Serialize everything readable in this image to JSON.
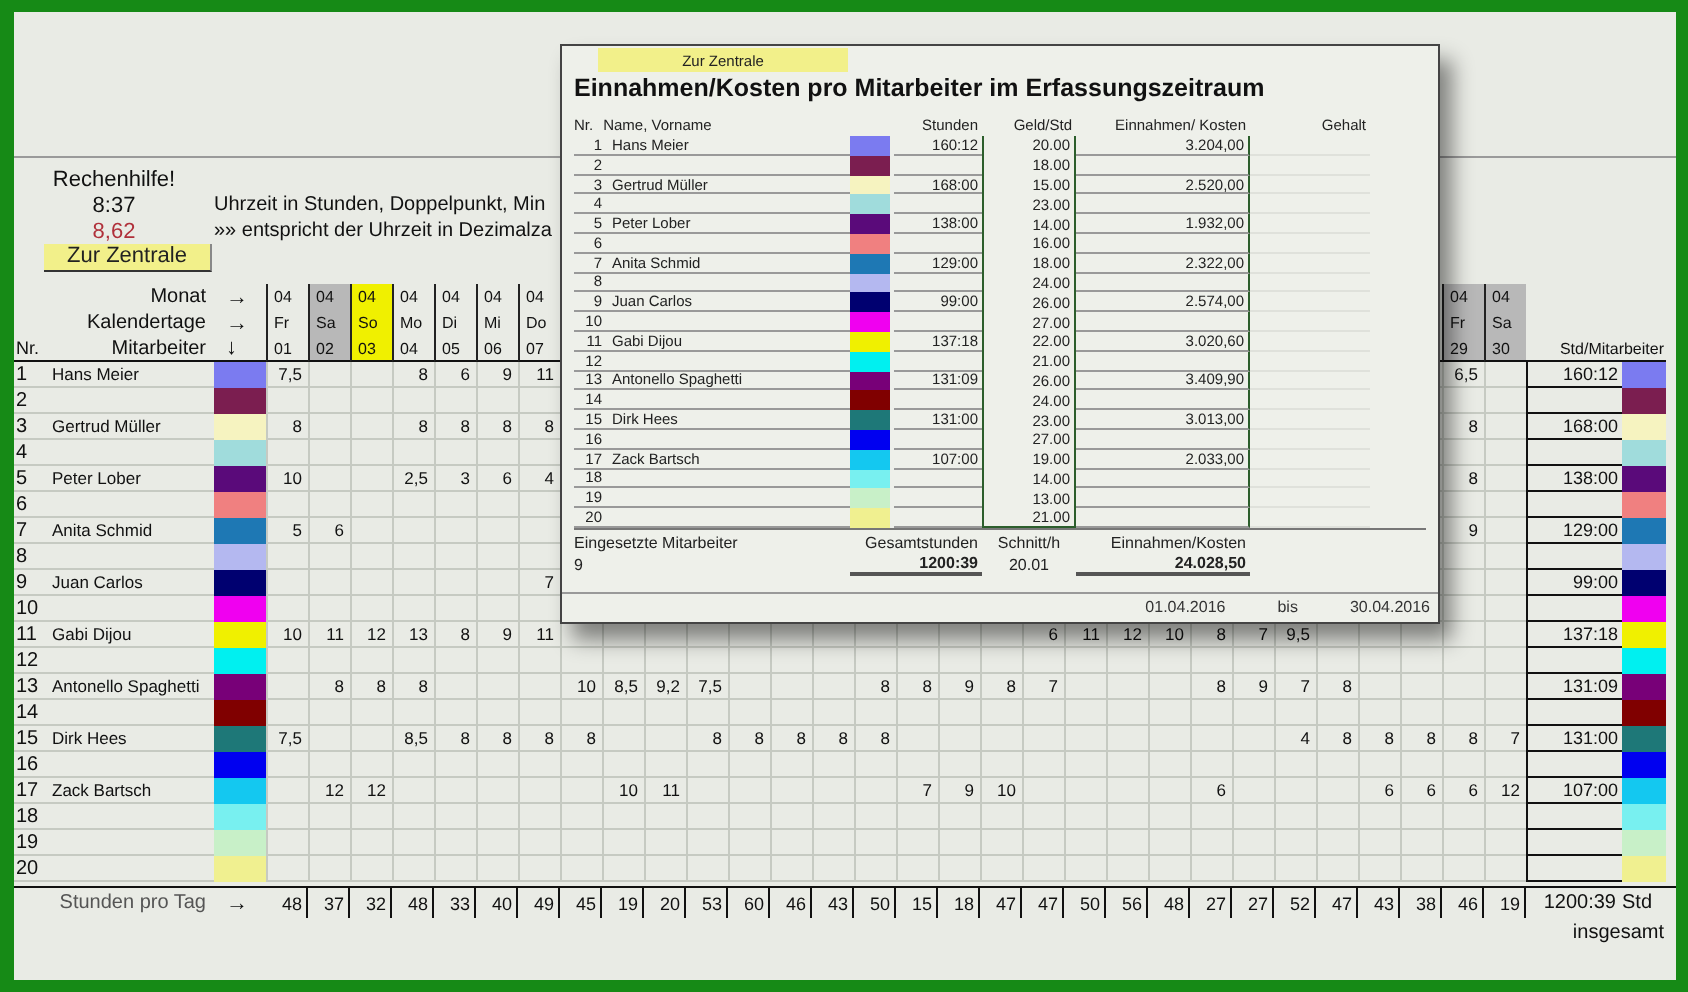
{
  "helper": {
    "title": "Rechenhilfe!",
    "time": "8:37",
    "decimal": "8,62",
    "line_1": "Uhrzeit in Stunden, Doppelpunkt, Min",
    "line_2": "»» entspricht der Uhrzeit in Dezimalza",
    "button": "Zur Zentrale"
  },
  "header": {
    "nr": "Nr.",
    "labels": [
      {
        "label": "Monat",
        "arrow": "→"
      },
      {
        "label": "Kalendertage",
        "arrow": "→"
      },
      {
        "label": "Mitarbeiter",
        "arrow": "↓"
      }
    ],
    "total_heading": "Std/Mitarbeiter"
  },
  "days_start": [
    {
      "month": "04",
      "weekday": "Fr",
      "date": "01",
      "kind": "normal"
    },
    {
      "month": "04",
      "weekday": "Sa",
      "date": "02",
      "kind": "gray"
    },
    {
      "month": "04",
      "weekday": "So",
      "date": "03",
      "kind": "yellow"
    },
    {
      "month": "04",
      "weekday": "Mo",
      "date": "04",
      "kind": "normal"
    },
    {
      "month": "04",
      "weekday": "Di",
      "date": "05",
      "kind": "normal"
    },
    {
      "month": "04",
      "weekday": "Mi",
      "date": "06",
      "kind": "normal"
    },
    {
      "month": "04",
      "weekday": "Do",
      "date": "07",
      "kind": "normal"
    }
  ],
  "days_end": [
    {
      "month": "04",
      "weekday": "Fr",
      "date": "29",
      "kind": "gray"
    },
    {
      "month": "04",
      "weekday": "Sa",
      "date": "30",
      "kind": "gray"
    }
  ],
  "rows": [
    {
      "nr": "1",
      "name": "Hans Meier",
      "color": "#7b7bf0",
      "total": "160:12",
      "cells": [
        "7,5",
        null,
        null,
        "8",
        "6",
        "9",
        "11",
        null,
        null,
        null,
        null,
        null,
        null,
        null,
        null,
        null,
        null,
        null,
        null,
        null,
        null,
        null,
        null,
        null,
        null,
        null,
        null,
        null,
        "6,5",
        null
      ]
    },
    {
      "nr": "2",
      "color": "#7b1e50"
    },
    {
      "nr": "3",
      "name": "Gertrud Müller",
      "color": "#f6f3c0",
      "total": "168:00",
      "cells": [
        "8",
        null,
        null,
        "8",
        "8",
        "8",
        "8",
        null,
        null,
        null,
        null,
        null,
        null,
        null,
        null,
        null,
        null,
        null,
        null,
        null,
        null,
        null,
        null,
        null,
        null,
        null,
        null,
        null,
        "8",
        null
      ]
    },
    {
      "nr": "4",
      "color": "#a0dcdc"
    },
    {
      "nr": "5",
      "name": "Peter Lober",
      "color": "#5a0a7a",
      "total": "138:00",
      "cells": [
        "10",
        null,
        null,
        "2,5",
        "3",
        "6",
        "4",
        null,
        null,
        null,
        null,
        null,
        null,
        null,
        null,
        null,
        null,
        null,
        null,
        null,
        null,
        null,
        null,
        null,
        null,
        null,
        null,
        null,
        "8",
        null
      ]
    },
    {
      "nr": "6",
      "color": "#f08080"
    },
    {
      "nr": "7",
      "name": "Anita Schmid",
      "color": "#1e78b4",
      "total": "129:00",
      "cells": [
        "5",
        "6",
        null,
        null,
        null,
        null,
        null,
        null,
        null,
        null,
        null,
        null,
        null,
        null,
        null,
        null,
        null,
        null,
        null,
        null,
        null,
        null,
        null,
        null,
        null,
        null,
        null,
        null,
        "9",
        null
      ]
    },
    {
      "nr": "8",
      "color": "#b4b8f0"
    },
    {
      "nr": "9",
      "name": "Juan Carlos",
      "color": "#000070",
      "total": "99:00",
      "cells": [
        null,
        null,
        null,
        null,
        null,
        null,
        "7",
        null,
        null,
        null,
        null,
        null,
        null,
        null,
        null,
        null,
        null,
        null,
        null,
        null,
        null,
        null,
        null,
        null,
        null,
        null,
        null,
        null,
        null,
        null
      ]
    },
    {
      "nr": "10",
      "color": "#f000f0"
    },
    {
      "nr": "11",
      "name": "Gabi Dijou",
      "color": "#f0f000",
      "total": "137:18",
      "cells": [
        "10",
        "11",
        "12",
        "13",
        "8",
        "9",
        "11",
        null,
        null,
        null,
        null,
        null,
        null,
        null,
        null,
        null,
        null,
        null,
        "6",
        "11",
        "12",
        "10",
        "8",
        "7",
        "9,5",
        null,
        null,
        null,
        null,
        null
      ]
    },
    {
      "nr": "12",
      "color": "#00f0f0"
    },
    {
      "nr": "13",
      "name": "Antonello Spaghetti",
      "color": "#780078",
      "total": "131:09",
      "cells": [
        null,
        "8",
        "8",
        "8",
        null,
        null,
        null,
        "10",
        "8,5",
        "9,2",
        "7,5",
        null,
        null,
        null,
        "8",
        "8",
        "9",
        "8",
        "7",
        null,
        null,
        null,
        "8",
        "9",
        "7",
        "8",
        null,
        null,
        null,
        null
      ]
    },
    {
      "nr": "14",
      "color": "#800000"
    },
    {
      "nr": "15",
      "name": "Dirk Hees",
      "color": "#1e7878",
      "total": "131:00",
      "cells": [
        "7,5",
        null,
        null,
        "8,5",
        "8",
        "8",
        "8",
        "8",
        null,
        null,
        "8",
        "8",
        "8",
        "8",
        "8",
        null,
        null,
        null,
        null,
        null,
        null,
        null,
        null,
        null,
        "4",
        "8",
        "8",
        "8",
        "8",
        "7"
      ]
    },
    {
      "nr": "16",
      "color": "#0000f0"
    },
    {
      "nr": "17",
      "name": "Zack Bartsch",
      "color": "#14c8f0",
      "total": "107:00",
      "cells": [
        null,
        "12",
        "12",
        null,
        null,
        null,
        null,
        null,
        "10",
        "11",
        null,
        null,
        null,
        null,
        null,
        "7",
        "9",
        "10",
        null,
        null,
        null,
        null,
        "6",
        null,
        null,
        null,
        "6",
        "6",
        "6",
        "12"
      ]
    },
    {
      "nr": "18",
      "color": "#78f0f0"
    },
    {
      "nr": "19",
      "color": "#c8f0c8"
    },
    {
      "nr": "20",
      "color": "#f0f090"
    }
  ],
  "totals": {
    "label": "Stunden pro Tag",
    "arrow": "→",
    "values": [
      "48",
      "37",
      "32",
      "48",
      "33",
      "40",
      "49",
      "45",
      "19",
      "20",
      "53",
      "60",
      "46",
      "43",
      "50",
      "15",
      "18",
      "47",
      "47",
      "50",
      "56",
      "48",
      "27",
      "27",
      "52",
      "47",
      "43",
      "38",
      "46",
      "19"
    ],
    "grand_total": "1200:39",
    "unit": "Std",
    "note": "insgesamt"
  },
  "summary": {
    "button": "Zur Zentrale",
    "title": "Einnahmen/Kosten pro Mitarbeiter im Erfassungszeitraum",
    "columns": {
      "nr": "Nr.",
      "name": "Name, Vorname",
      "hours": "Stunden",
      "rate": "Geld/Std",
      "revenue": "Einnahmen/ Kosten",
      "salary": "Gehalt"
    },
    "rows": [
      {
        "nr": "1",
        "name": "Hans Meier",
        "color": "#7b7bf0",
        "hours": "160:12",
        "rate": "20.00",
        "revenue": "3.204,00"
      },
      {
        "nr": "2",
        "color": "#7b1e50",
        "rate": "18.00"
      },
      {
        "nr": "3",
        "name": "Gertrud Müller",
        "color": "#f6f3c0",
        "hours": "168:00",
        "rate": "15.00",
        "revenue": "2.520,00"
      },
      {
        "nr": "4",
        "color": "#a0dcdc",
        "rate": "23.00"
      },
      {
        "nr": "5",
        "name": "Peter Lober",
        "color": "#5a0a7a",
        "hours": "138:00",
        "rate": "14.00",
        "revenue": "1.932,00"
      },
      {
        "nr": "6",
        "color": "#f08080",
        "rate": "16.00"
      },
      {
        "nr": "7",
        "name": "Anita Schmid",
        "color": "#1e78b4",
        "hours": "129:00",
        "rate": "18.00",
        "revenue": "2.322,00"
      },
      {
        "nr": "8",
        "color": "#b4b8f0",
        "rate": "24.00"
      },
      {
        "nr": "9",
        "name": "Juan Carlos",
        "color": "#000070",
        "hours": "99:00",
        "rate": "26.00",
        "revenue": "2.574,00"
      },
      {
        "nr": "10",
        "color": "#f000f0",
        "rate": "27.00"
      },
      {
        "nr": "11",
        "name": "Gabi Dijou",
        "color": "#f0f000",
        "hours": "137:18",
        "rate": "22.00",
        "revenue": "3.020,60"
      },
      {
        "nr": "12",
        "color": "#00f0f0",
        "rate": "21.00"
      },
      {
        "nr": "13",
        "name": "Antonello Spaghetti",
        "color": "#780078",
        "hours": "131:09",
        "rate": "26.00",
        "revenue": "3.409,90"
      },
      {
        "nr": "14",
        "color": "#800000",
        "rate": "24.00"
      },
      {
        "nr": "15",
        "name": "Dirk Hees",
        "color": "#1e7878",
        "hours": "131:00",
        "rate": "23.00",
        "revenue": "3.013,00"
      },
      {
        "nr": "16",
        "color": "#0000f0",
        "rate": "27.00"
      },
      {
        "nr": "17",
        "name": "Zack Bartsch",
        "color": "#14c8f0",
        "hours": "107:00",
        "rate": "19.00",
        "revenue": "2.033,00"
      },
      {
        "nr": "18",
        "color": "#78f0f0",
        "rate": "14.00"
      },
      {
        "nr": "19",
        "color": "#c8f0c8",
        "rate": "13.00"
      },
      {
        "nr": "20",
        "color": "#f0f090",
        "rate": "21.00"
      }
    ],
    "footer": {
      "staff_label": "Eingesetzte Mitarbeiter",
      "staff_count": "9",
      "hours_label": "Gesamtstunden",
      "hours_total": "1200:39",
      "average_label": "Schnitt/h",
      "average": "20.01",
      "revenue_label": "Einnahmen/Kosten",
      "revenue_total": "24.028,50"
    },
    "period": {
      "from": "01.04.2016",
      "separator": "bis",
      "to": "30.04.2016"
    }
  }
}
